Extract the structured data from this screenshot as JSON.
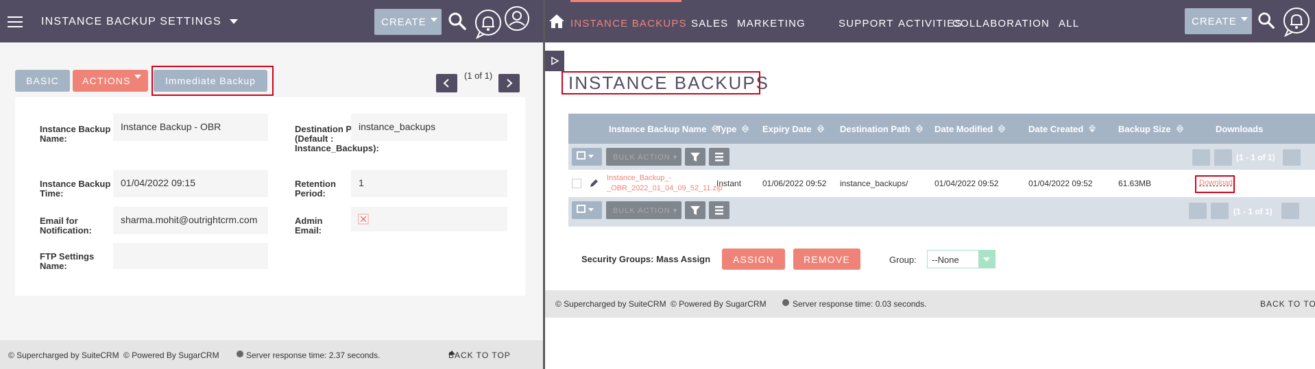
{
  "left": {
    "nav": {
      "module_title": "INSTANCE BACKUP SETTINGS",
      "create_label": "CREATE"
    },
    "tabs": {
      "basic": "BASIC",
      "actions": "ACTIONS",
      "immediate": "Immediate Backup"
    },
    "pagination": "(1 of 1)",
    "fields": {
      "backup_name_label": "Instance Backup Name:",
      "backup_name_value": "Instance Backup - OBR",
      "dest_path_label": "Destination Path (Default : Instance_Backups):",
      "dest_path_value": "instance_backups",
      "backup_time_label": "Instance Backup Time:",
      "backup_time_value": "01/04/2022 09:15",
      "retention_label": "Retention Period:",
      "retention_value": "1",
      "email_label": "Email for Notification:",
      "email_value": "sharma.mohit@outrightcrm.com",
      "admin_email_label": "Admin Email:",
      "ftp_label": "FTP Settings Name:",
      "ftp_value": ""
    },
    "footer": {
      "suitecrm": "© Supercharged by SuiteCRM",
      "sugarcrm": "© Powered By SugarCRM",
      "response": "Server response time: 2.37 seconds.",
      "back_to_top": "BACK TO TOP"
    }
  },
  "right": {
    "nav": {
      "items": [
        "INSTANCE BACKUPS",
        "SALES",
        "MARKETING",
        "SUPPORT",
        "ACTIVITIES",
        "COLLABORATION",
        "ALL"
      ],
      "create_label": "CREATE"
    },
    "page_title": "INSTANCE BACKUPS",
    "table": {
      "headers": [
        "Instance Backup Name",
        "Type",
        "Expiry Date",
        "Destination Path",
        "Date Modified",
        "Date Created",
        "Backup Size",
        "Downloads"
      ],
      "bulk_action": "BULK ACTION",
      "pagination": "(1 - 1 of 1)",
      "row": {
        "name_line1": "Instance_Backup_-",
        "name_line2": "_OBR_2022_01_04_09_52_11.zip",
        "type": "Instant",
        "expiry": "01/06/2022 09:52",
        "dest": "instance_backups/",
        "modified": "01/04/2022 09:52",
        "created": "01/04/2022 09:52",
        "size": "61.63MB",
        "download": "Download"
      }
    },
    "security": {
      "label": "Security Groups: Mass Assign",
      "assign": "ASSIGN",
      "remove": "REMOVE",
      "group_label": "Group:",
      "group_value": "--None"
    },
    "footer": {
      "suitecrm": "© Supercharged by SuiteCRM",
      "sugarcrm": "© Powered By SugarCRM",
      "response": "Server response time: 0.03 seconds.",
      "back_to_top": "BACK TO TO"
    }
  },
  "colors": {
    "nav": "#534d64",
    "accent": "#f08377",
    "button_grey": "#a5b4c4",
    "highlight": "#d0021b"
  }
}
